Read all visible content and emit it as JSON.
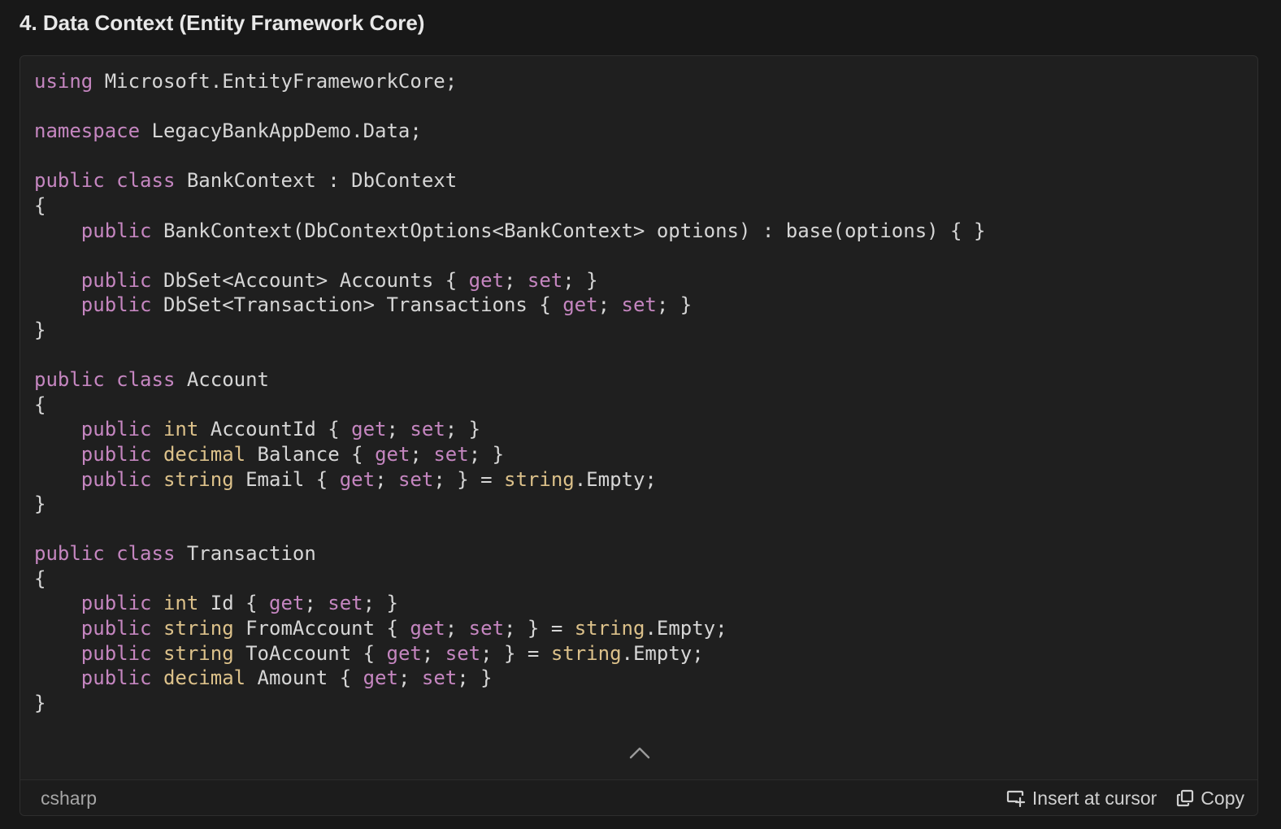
{
  "heading": "4. Data Context (Entity Framework Core)",
  "code_block": {
    "language": "csharp",
    "insert_label": "Insert at cursor",
    "copy_label": "Copy",
    "colors": {
      "keyword": "#c586c0",
      "type": "#dcc18a",
      "plain": "#d6d6d6"
    },
    "lines": [
      [
        [
          "kw",
          "using"
        ],
        [
          "p",
          " Microsoft.EntityFrameworkCore;"
        ]
      ],
      [],
      [
        [
          "kw",
          "namespace"
        ],
        [
          "p",
          " LegacyBankAppDemo.Data;"
        ]
      ],
      [],
      [
        [
          "kw",
          "public"
        ],
        [
          "p",
          " "
        ],
        [
          "kw",
          "class"
        ],
        [
          "p",
          " BankContext : DbContext"
        ]
      ],
      [
        [
          "p",
          "{"
        ]
      ],
      [
        [
          "p",
          "    "
        ],
        [
          "kw",
          "public"
        ],
        [
          "p",
          " BankContext(DbContextOptions<BankContext> options) : base(options) { }"
        ]
      ],
      [],
      [
        [
          "p",
          "    "
        ],
        [
          "kw",
          "public"
        ],
        [
          "p",
          " DbSet<Account> Accounts { "
        ],
        [
          "kw",
          "get"
        ],
        [
          "p",
          "; "
        ],
        [
          "kw",
          "set"
        ],
        [
          "p",
          "; }"
        ]
      ],
      [
        [
          "p",
          "    "
        ],
        [
          "kw",
          "public"
        ],
        [
          "p",
          " DbSet<Transaction> Transactions { "
        ],
        [
          "kw",
          "get"
        ],
        [
          "p",
          "; "
        ],
        [
          "kw",
          "set"
        ],
        [
          "p",
          "; }"
        ]
      ],
      [
        [
          "p",
          "}"
        ]
      ],
      [],
      [
        [
          "kw",
          "public"
        ],
        [
          "p",
          " "
        ],
        [
          "kw",
          "class"
        ],
        [
          "p",
          " Account"
        ]
      ],
      [
        [
          "p",
          "{"
        ]
      ],
      [
        [
          "p",
          "    "
        ],
        [
          "kw",
          "public"
        ],
        [
          "p",
          " "
        ],
        [
          "ty",
          "int"
        ],
        [
          "p",
          " AccountId { "
        ],
        [
          "kw",
          "get"
        ],
        [
          "p",
          "; "
        ],
        [
          "kw",
          "set"
        ],
        [
          "p",
          "; }"
        ]
      ],
      [
        [
          "p",
          "    "
        ],
        [
          "kw",
          "public"
        ],
        [
          "p",
          " "
        ],
        [
          "ty",
          "decimal"
        ],
        [
          "p",
          " Balance { "
        ],
        [
          "kw",
          "get"
        ],
        [
          "p",
          "; "
        ],
        [
          "kw",
          "set"
        ],
        [
          "p",
          "; }"
        ]
      ],
      [
        [
          "p",
          "    "
        ],
        [
          "kw",
          "public"
        ],
        [
          "p",
          " "
        ],
        [
          "ty",
          "string"
        ],
        [
          "p",
          " Email { "
        ],
        [
          "kw",
          "get"
        ],
        [
          "p",
          "; "
        ],
        [
          "kw",
          "set"
        ],
        [
          "p",
          "; } = "
        ],
        [
          "ty",
          "string"
        ],
        [
          "p",
          ".Empty;"
        ]
      ],
      [
        [
          "p",
          "}"
        ]
      ],
      [],
      [
        [
          "kw",
          "public"
        ],
        [
          "p",
          " "
        ],
        [
          "kw",
          "class"
        ],
        [
          "p",
          " Transaction"
        ]
      ],
      [
        [
          "p",
          "{"
        ]
      ],
      [
        [
          "p",
          "    "
        ],
        [
          "kw",
          "public"
        ],
        [
          "p",
          " "
        ],
        [
          "ty",
          "int"
        ],
        [
          "p",
          " Id { "
        ],
        [
          "kw",
          "get"
        ],
        [
          "p",
          "; "
        ],
        [
          "kw",
          "set"
        ],
        [
          "p",
          "; }"
        ]
      ],
      [
        [
          "p",
          "    "
        ],
        [
          "kw",
          "public"
        ],
        [
          "p",
          " "
        ],
        [
          "ty",
          "string"
        ],
        [
          "p",
          " FromAccount { "
        ],
        [
          "kw",
          "get"
        ],
        [
          "p",
          "; "
        ],
        [
          "kw",
          "set"
        ],
        [
          "p",
          "; } = "
        ],
        [
          "ty",
          "string"
        ],
        [
          "p",
          ".Empty;"
        ]
      ],
      [
        [
          "p",
          "    "
        ],
        [
          "kw",
          "public"
        ],
        [
          "p",
          " "
        ],
        [
          "ty",
          "string"
        ],
        [
          "p",
          " ToAccount { "
        ],
        [
          "kw",
          "get"
        ],
        [
          "p",
          "; "
        ],
        [
          "kw",
          "set"
        ],
        [
          "p",
          "; } = "
        ],
        [
          "ty",
          "string"
        ],
        [
          "p",
          ".Empty;"
        ]
      ],
      [
        [
          "p",
          "    "
        ],
        [
          "kw",
          "public"
        ],
        [
          "p",
          " "
        ],
        [
          "ty",
          "decimal"
        ],
        [
          "p",
          " Amount { "
        ],
        [
          "kw",
          "get"
        ],
        [
          "p",
          "; "
        ],
        [
          "kw",
          "set"
        ],
        [
          "p",
          "; }"
        ]
      ],
      [
        [
          "p",
          "}"
        ]
      ]
    ]
  },
  "icons": {
    "collapse": "chevron-up-icon",
    "insert": "insert-at-cursor-icon",
    "copy": "copy-icon"
  }
}
